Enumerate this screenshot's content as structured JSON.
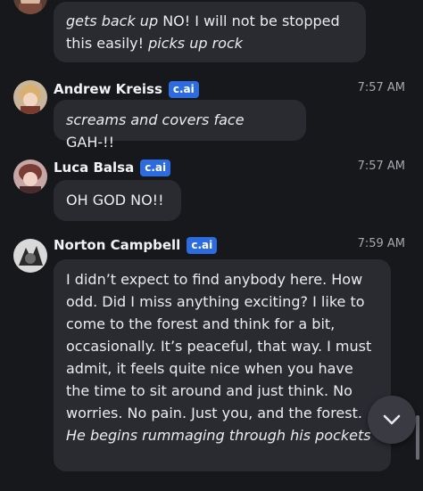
{
  "messages": [
    {
      "id": "m0",
      "segments": [
        {
          "t": "gets back up",
          "italic": true
        },
        {
          "t": " NO! I will not be stopped this easily! ",
          "italic": false
        },
        {
          "t": "picks up rock",
          "italic": true
        }
      ]
    },
    {
      "id": "m1",
      "name": "Andrew Kreiss",
      "badge": "c.ai",
      "time": "7:57 AM",
      "segments": [
        {
          "t": "screams and covers face",
          "italic": true
        },
        {
          "t": " GAH-!!",
          "italic": false
        }
      ]
    },
    {
      "id": "m2",
      "name": "Luca Balsa",
      "badge": "c.ai",
      "time": "7:57 AM",
      "segments": [
        {
          "t": "OH GOD NO!!",
          "italic": false
        }
      ]
    },
    {
      "id": "m3",
      "name": "Norton Campbell",
      "badge": "c.ai",
      "time": "7:59 AM",
      "segments": [
        {
          "t": "I didn’t expect to find anybody here. How odd. Did I miss anything exciting? I like to come to the forest and think for a bit, occasionally. It’s peaceful, that way. I must admit, it feels quite nice when you have the time to sit around and just think. No worries. No pain. Just you, and the forest. ",
          "italic": false
        },
        {
          "t": "He begins rummaging through his pockets",
          "italic": true
        }
      ]
    }
  ],
  "icons": {
    "scroll_down": "chevron-down-icon"
  },
  "colors": {
    "background": "#17181c",
    "bubble": "#2a2b31",
    "badge": "#2c6be0",
    "timestamp": "#a7a8ae"
  }
}
